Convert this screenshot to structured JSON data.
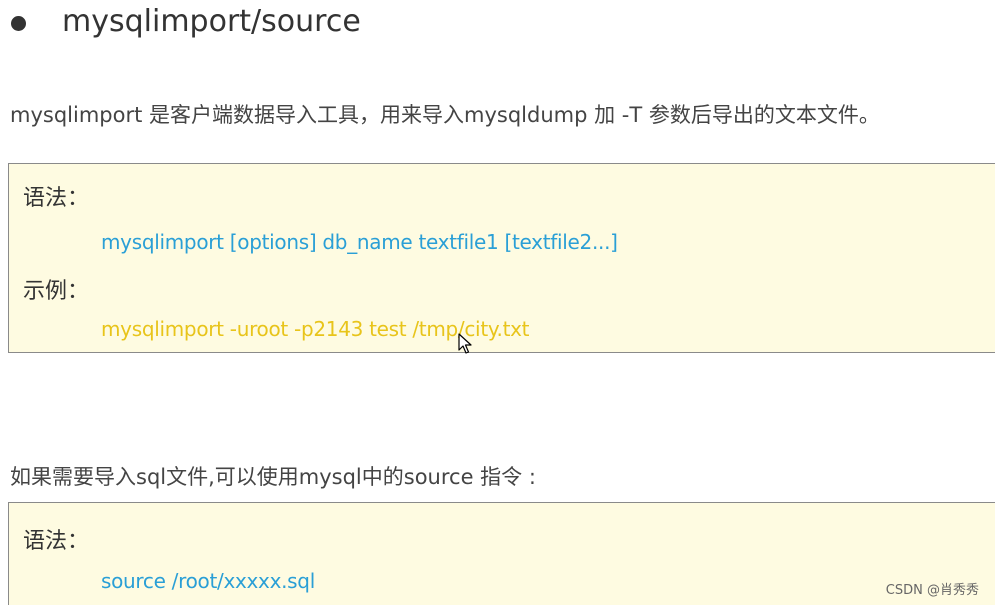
{
  "heading": {
    "title": "mysqlimport/source"
  },
  "intro": "mysqlimport 是客户端数据导入工具，用来导入mysqldump 加 -T 参数后导出的文本文件。",
  "box1": {
    "syntax_label": "语法：",
    "syntax_code": "mysqlimport [options]  db_name  textfile1  [textfile2...]",
    "example_label": "示例：",
    "example_code": "mysqlimport -uroot -p2143 test /tmp/city.txt"
  },
  "para2": "如果需要导入sql文件,可以使用mysql中的source 指令 :",
  "box2": {
    "syntax_label": "语法：",
    "syntax_code": "source /root/xxxxx.sql"
  },
  "watermark": "CSDN @肖秀秀",
  "colors": {
    "box_bg": "#fefbe1",
    "code_blue": "#2a9fd6",
    "code_yellow": "#e8c41a"
  }
}
